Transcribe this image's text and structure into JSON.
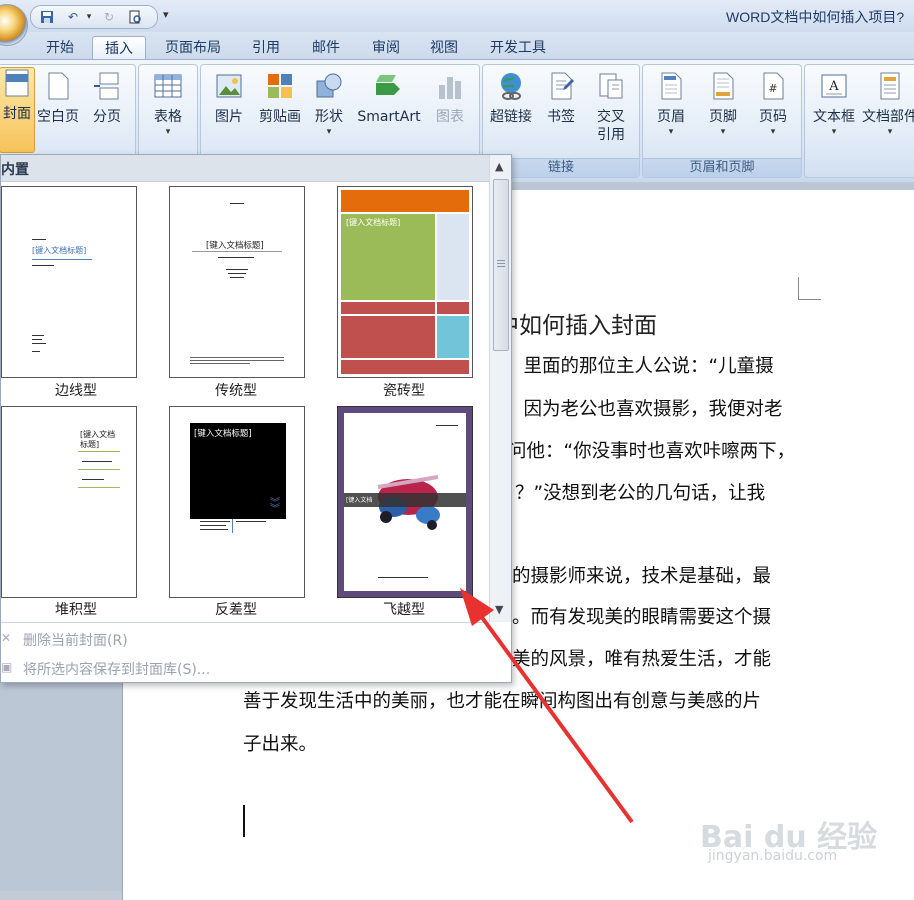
{
  "window": {
    "title": "WORD文档中如何插入项目?"
  },
  "quick_access": {
    "items": [
      "save-icon",
      "undo-icon",
      "redo-icon",
      "print-preview-icon"
    ],
    "more": "▾"
  },
  "tabs": [
    {
      "label": "开始",
      "active": false
    },
    {
      "label": "插入",
      "active": true
    },
    {
      "label": "页面布局",
      "active": false
    },
    {
      "label": "引用",
      "active": false
    },
    {
      "label": "邮件",
      "active": false
    },
    {
      "label": "审阅",
      "active": false
    },
    {
      "label": "视图",
      "active": false
    },
    {
      "label": "开发工具",
      "active": false
    }
  ],
  "ribbon": {
    "pages": {
      "cover": "封面",
      "blank": "空白页",
      "break": "分页"
    },
    "table": {
      "label": "表格"
    },
    "illustrations": {
      "picture": "图片",
      "clipart": "剪贴画",
      "shapes": "形状",
      "smartart": "SmartArt",
      "chart": "图表"
    },
    "links": {
      "hyperlink": "超链接",
      "bookmark": "书签",
      "crossref1": "交叉",
      "crossref2": "引用",
      "group": "链接"
    },
    "header_footer": {
      "header": "页眉",
      "footer": "页脚",
      "page_number": "页码",
      "group": "页眉和页脚"
    },
    "text": {
      "textbox": "文本框",
      "quickparts": "文档部件"
    }
  },
  "gallery": {
    "header": "内置",
    "items": [
      {
        "caption": "边线型"
      },
      {
        "caption": "传统型"
      },
      {
        "caption": "瓷砖型"
      },
      {
        "caption": "堆积型"
      },
      {
        "caption": "反差型"
      },
      {
        "caption": "飞越型"
      }
    ],
    "placeholder_title": "[键入文档标题]",
    "placeholder_title_split1": "[键入文档",
    "placeholder_title_split2": "标题]",
    "placeholder_subtitle": "[键入文档副标题]",
    "placeholder_author": "[键入作者姓名]",
    "remove_cover": "删除当前封面(R)",
    "save_selection": "将所选内容保存到封面库(S)..."
  },
  "document": {
    "heading": "中如何插入封面",
    "lines": [
      "。里面的那位主人公说：“儿童摄",
      "。因为老公也喜欢摄影，我便对老",
      "问他：“你没事时也喜欢咔嚓两下，",
      "？”没想到老公的几句话，让我",
      "的摄影师来说，技术是基础，最",
      "。而有发现美的眼睛需要这个摄",
      "美的风景，唯有热爱生活，才能",
      "善于发现生活中的美丽，也才能在瞬间构图出有创意与美感的片",
      "子出来。"
    ]
  },
  "watermark": {
    "brand": "Bai du 经验",
    "url": "jingyan.baidu.com"
  },
  "colors": {
    "annotation_arrow": "#e8322f",
    "ribbon_bg": "#dbe6f4",
    "tile_orange": "#e46c0a",
    "tile_green": "#9bbb59",
    "tile_red": "#c0504d",
    "tile_blue": "#72c4d9",
    "flyover_purple": "#5f4b7b"
  }
}
